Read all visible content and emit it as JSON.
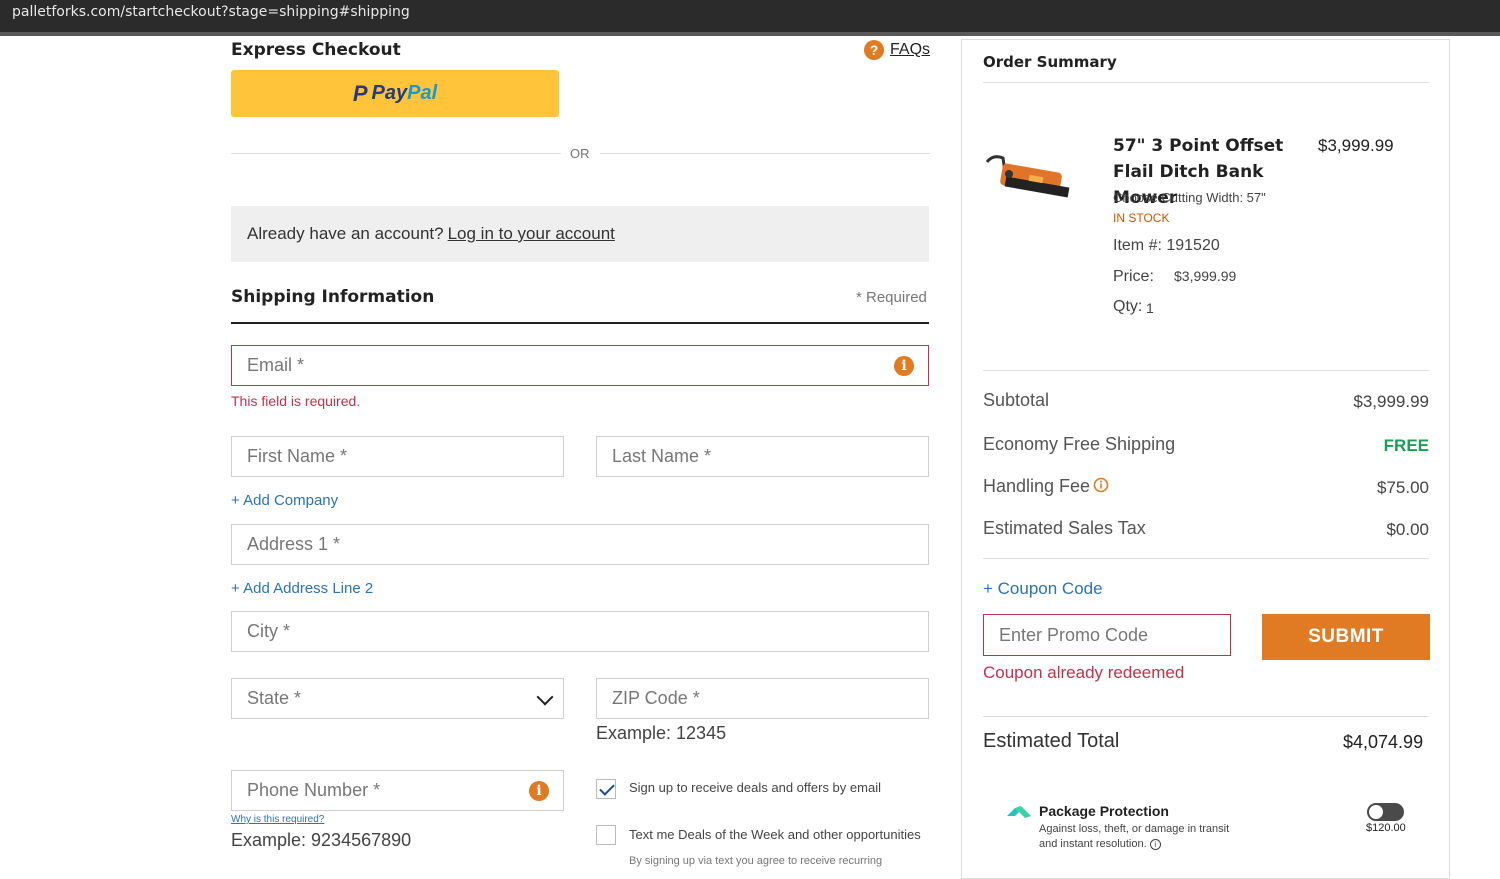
{
  "browser": {
    "url": "palletforks.com/startcheckout?stage=shipping#shipping"
  },
  "express": {
    "title": "Express Checkout",
    "faq_label": "FAQs",
    "paypal_a": "Pay",
    "paypal_b": "Pal",
    "or_label": "OR"
  },
  "account": {
    "prompt": "Already have an account?",
    "login_link": "Log in to your account"
  },
  "shipping": {
    "title": "Shipping Information",
    "required_note": "* Required",
    "email_placeholder": "Email *",
    "email_error": "This field is required.",
    "first_name_placeholder": "First Name *",
    "last_name_placeholder": "Last Name *",
    "add_company": "+ Add Company",
    "address1_placeholder": "Address 1 *",
    "add_address2": "+ Add Address Line 2",
    "city_placeholder": "City *",
    "state_placeholder": "State *",
    "zip_placeholder": "ZIP Code *",
    "zip_example": "Example: 12345",
    "phone_placeholder": "Phone Number *",
    "why_required": "Why is this required?",
    "phone_example": "Example: 9234567890",
    "email_optin_label": "Sign up to receive deals and offers by email",
    "email_optin_checked": true,
    "sms_optin_label": "Text me Deals of the Week and other opportunities",
    "sms_optin_checked": false,
    "sms_fineprint": "By signing up via text you agree to receive recurring"
  },
  "summary": {
    "title": "Order Summary",
    "product": {
      "name": "57\" 3 Point Offset Flail Ditch Bank Mower",
      "price": "$3,999.99",
      "option": "Choose Cutting Width: 57\"",
      "stock": "IN STOCK",
      "item_no": "Item #: 191520",
      "price_label": "Price:",
      "price_value": "$3,999.99",
      "qty_label": "Qty:",
      "qty_value": "1"
    },
    "subtotal_label": "Subtotal",
    "subtotal_value": "$3,999.99",
    "shipping_label": "Economy Free Shipping",
    "shipping_value": "FREE",
    "handling_label": "Handling Fee",
    "handling_value": "$75.00",
    "tax_label": "Estimated Sales Tax",
    "tax_value": "$0.00",
    "coupon_link": "+ Coupon Code",
    "promo_placeholder": "Enter Promo Code",
    "submit_label": "SUBMIT",
    "coupon_error": "Coupon already redeemed",
    "total_label": "Estimated Total",
    "total_value": "$4,074.99",
    "protection_title": "Package Protection",
    "protection_sub": "Against loss, theft, or damage in transit and instant resolution.",
    "protection_price": "$120.00"
  },
  "colors": {
    "accent": "#e07b23",
    "error": "#c4314b",
    "link": "#2a73b8",
    "paypal": "#ffc43a"
  }
}
